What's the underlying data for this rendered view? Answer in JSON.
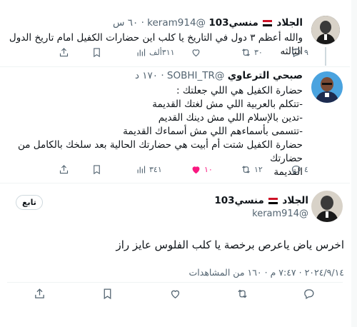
{
  "tweets": [
    {
      "name": "الجلاد",
      "name_suffix": "منسي103",
      "handle": "@keram914",
      "time": "٦٠ س",
      "text": "والله  أعظم ٣ دول في التاريخ يا كلب اين حضارات الكفيل امام تاريخ الدول الثالثه",
      "stats": {
        "replies": "٩",
        "reposts": "٣٠",
        "likes": "",
        "views": "٣١١ألف"
      }
    },
    {
      "name": "صبحي الترعاوي",
      "handle": "@SOBHI_TR",
      "time": "١٧٠ د",
      "lines": [
        "حضارة الكفيل هي اللي جعلتك :",
        "-تتكلم بالعربية اللي مش لغتك القديمة",
        "-تدين بالإسلام اللي مش دينك القديم",
        "-تتسمى بأسماءهم اللي مش أسماءك القديمة",
        "حضارة الكفيل شتت أم أبيت هي حضارتك الحالية بعد سلخك بالكامل من حضارتك",
        "القديمة"
      ],
      "stats": {
        "replies": "٤",
        "reposts": "١٢",
        "likes": "١٠",
        "views": "٣٤١"
      }
    },
    {
      "name": "الجلاد",
      "name_suffix": "منسي103",
      "handle": "@keram914",
      "follow": "تابع",
      "text": "اخرس ياض ياعرص برخصة يا كلب الفلوس عايز راز",
      "meta": "٢٠٢٤/٩/١٤ · ٧:٤٧ م · ١٦٠ من المشاهدات"
    }
  ],
  "colors": {
    "like_active": "#f91880",
    "muted": "#536471"
  }
}
